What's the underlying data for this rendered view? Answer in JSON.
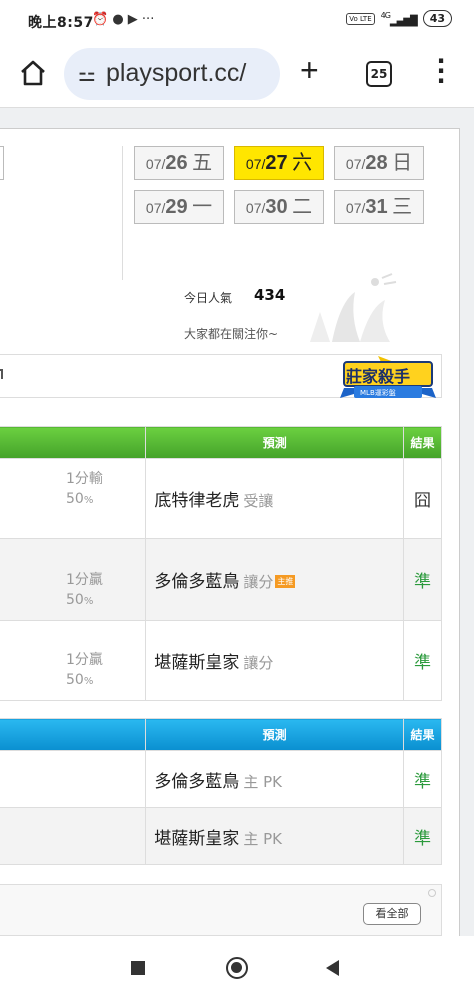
{
  "status_bar": {
    "time": "晚上8:57",
    "left_icons": "⏰ ● ▶ ···",
    "volte": "Vo LTE",
    "network": "4G",
    "battery": "43"
  },
  "browser": {
    "url": "playsport.cc/",
    "tab_count": "25"
  },
  "dates": [
    {
      "md": "07/",
      "d": "26",
      "wk": "五",
      "active": false
    },
    {
      "md": "07/",
      "d": "27",
      "wk": "六",
      "active": true
    },
    {
      "md": "07/",
      "d": "28",
      "wk": "日",
      "active": false
    },
    {
      "md": "07/",
      "d": "29",
      "wk": "一",
      "active": false
    },
    {
      "md": "07/",
      "d": "30",
      "wk": "二",
      "active": false
    },
    {
      "md": "07/",
      "d": "31",
      "wk": "三",
      "active": false
    }
  ],
  "popularity": {
    "label": "今日人氣",
    "value": "434",
    "note": "大家都在關注你~"
  },
  "badge": {
    "title": "莊家殺手",
    "subtitle": "MLB運彩盤"
  },
  "table1": {
    "header_predict": "預測",
    "header_result": "結果",
    "rows": [
      {
        "odds": "1分輸",
        "pct": "50",
        "pct_unit": "%",
        "team": "底特律老虎",
        "sub": "受讓",
        "main_tag": "",
        "result": "囧",
        "win": false
      },
      {
        "odds": "1分贏",
        "pct": "50",
        "pct_unit": "%",
        "team": "多倫多藍鳥",
        "sub": "讓分",
        "main_tag": "主推",
        "result": "準",
        "win": true
      },
      {
        "odds": "1分贏",
        "pct": "50",
        "pct_unit": "%",
        "team": "堪薩斯皇家",
        "sub": "讓分",
        "main_tag": "",
        "result": "準",
        "win": true
      }
    ]
  },
  "table2": {
    "header_predict": "預測",
    "header_result": "結果",
    "rows": [
      {
        "team": "多倫多藍鳥",
        "sub": "主 PK",
        "result": "準"
      },
      {
        "team": "堪薩斯皇家",
        "sub": "主 PK",
        "result": "準"
      }
    ]
  },
  "see_all": "看全部",
  "colors": {
    "green_header": "#44a22a",
    "blue_header": "#0a8fd0",
    "active_date": "#ffe600",
    "win": "#2b9a3c",
    "tag": "#f59a23"
  }
}
